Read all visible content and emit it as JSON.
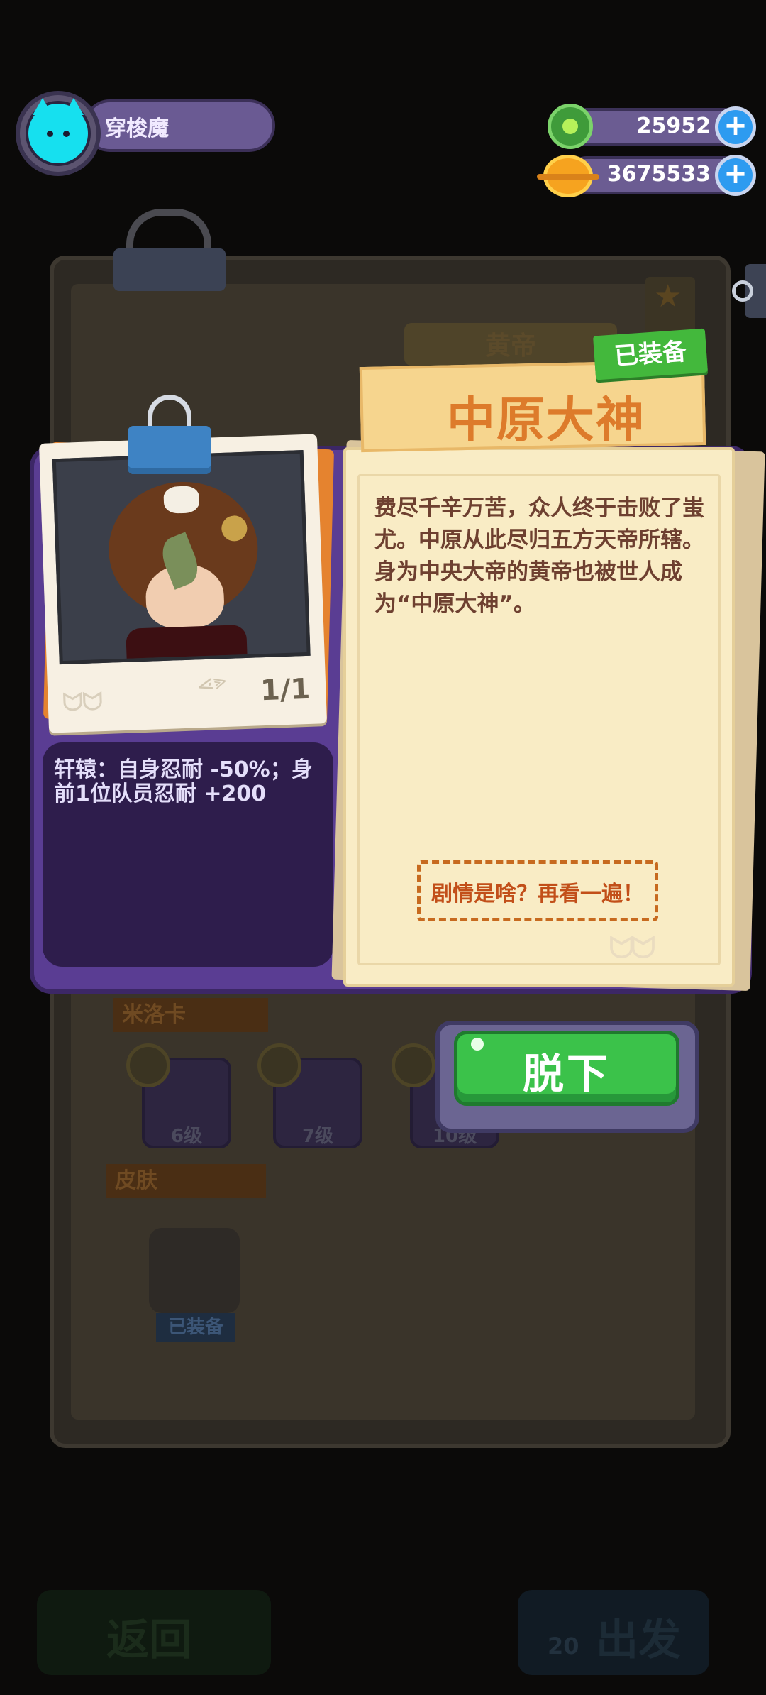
{
  "player": {
    "name": "穿梭魔"
  },
  "currencies": [
    {
      "icon": "gem-icon",
      "value": "25952"
    },
    {
      "icon": "coin-icon",
      "value": "3675533"
    }
  ],
  "background": {
    "character_name": "黄帝",
    "section_cards_label": "米洛卡",
    "cards": [
      {
        "level": "6级"
      },
      {
        "level": "7级"
      },
      {
        "level": "10级"
      }
    ],
    "section_skin_label": "皮肤",
    "skin_tag": "已装备",
    "bottom_left_label": "返回",
    "bottom_right_label": "出发",
    "bottom_right_count": "20"
  },
  "card_detail": {
    "title": "中原大神",
    "equipped_badge": "已装备",
    "count": "1/1",
    "skill": "轩辕：自身忍耐 -50%；身前1位队员忍耐 +200",
    "description": "费尽千辛万苦，众人终于击败了蚩尤。中原从此尽归五方天帝所辖。身为中央大帝的黄帝也被世人成为“中原大神”。",
    "story_button": "剧情是啥？再看一遍！",
    "action_button": "脱下"
  },
  "colors": {
    "panel": "#5a3d93",
    "paper": "#f9ecc5",
    "title_orange": "#dd7b2b",
    "button_green": "#3bc24a",
    "badge_green": "#43b83c"
  }
}
